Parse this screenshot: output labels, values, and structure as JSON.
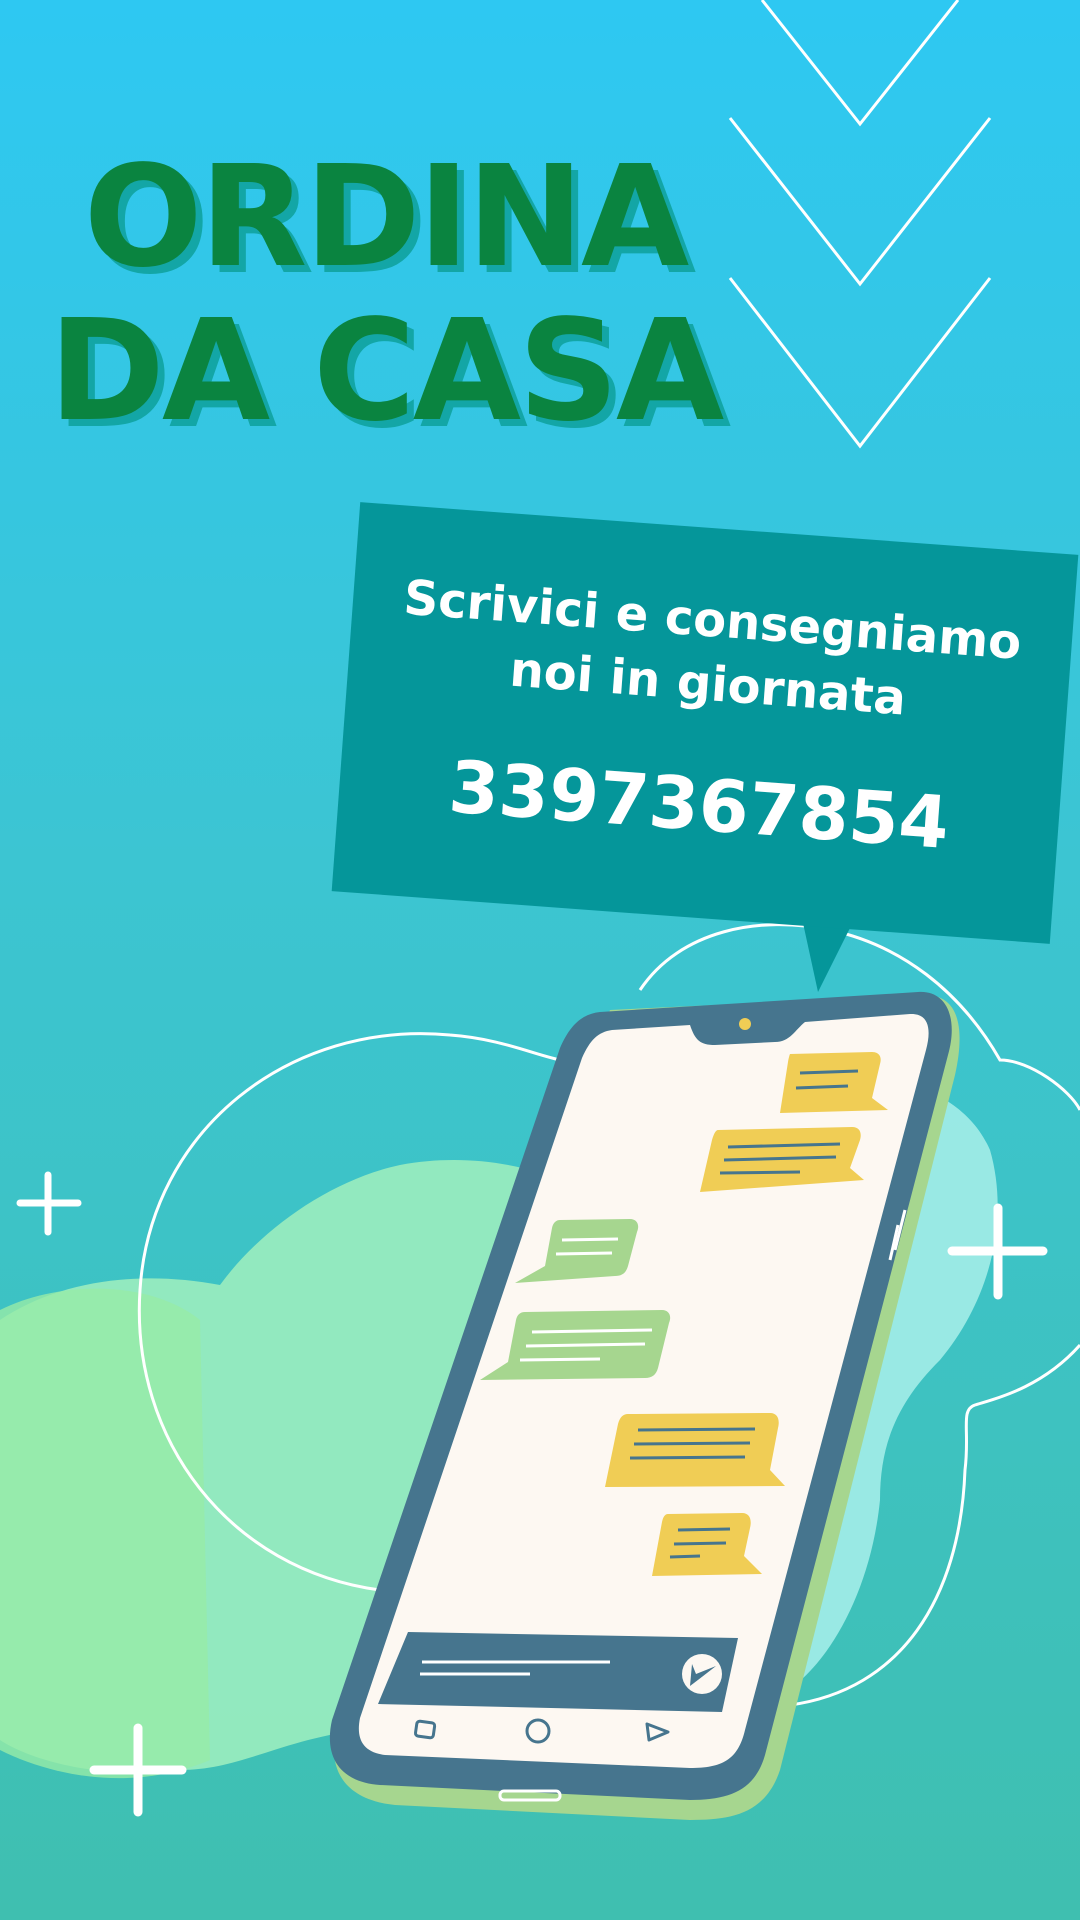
{
  "headline": {
    "line1": "ORDINA",
    "line2": "DA CASA"
  },
  "callout": {
    "message": "Scrivici e consegniamo noi in giornata",
    "phone": "3397367854"
  },
  "icons": [
    "chevron-down-icon",
    "plus-icon",
    "send-icon",
    "smartphone-illustration"
  ],
  "colors": {
    "background_top": "#2ec8f2",
    "background_bottom": "#3fbfb0",
    "headline": "#0a8440",
    "headline_shadow": "#13a6a6",
    "callout_bg": "#05969a",
    "phone_frame": "#46758e",
    "bubble_yellow": "#f0cd55",
    "bubble_green": "#a4d68e"
  }
}
